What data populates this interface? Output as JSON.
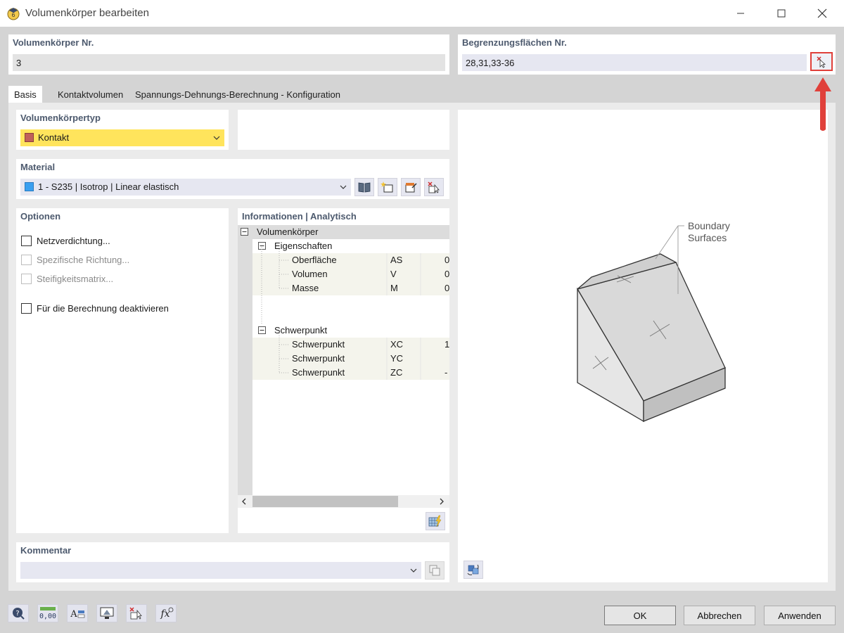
{
  "window": {
    "title": "Volumenkörper bearbeiten",
    "app_icon": "rfem-app-icon"
  },
  "solid_no": {
    "label": "Volumenkörper Nr.",
    "value": "3"
  },
  "boundary": {
    "label": "Begrenzungsflächen Nr.",
    "value": "28,31,33-36",
    "pick_icon": "pick-select-icon"
  },
  "tabs": [
    {
      "label": "Basis",
      "active": true
    },
    {
      "label": "Kontaktvolumen",
      "active": false
    },
    {
      "label": "Spannungs-Dehnungs-Berechnung - Konfiguration",
      "active": false
    }
  ],
  "solid_type": {
    "label": "Volumenkörpertyp",
    "value": "Kontakt",
    "swatch_color": "#c0605a",
    "bg_color": "#ffe45c"
  },
  "material": {
    "label": "Material",
    "value": "1 - S235 | Isotrop | Linear elastisch",
    "swatch_color": "#3aa0f0"
  },
  "options": {
    "label": "Optionen",
    "items": [
      {
        "label": "Netzverdichtung...",
        "enabled": true,
        "checked": false
      },
      {
        "label": "Spezifische Richtung...",
        "enabled": false,
        "checked": false
      },
      {
        "label": "Steifigkeitsmatrix...",
        "enabled": false,
        "checked": false
      },
      {
        "label": "Für die Berechnung deaktivieren",
        "enabled": true,
        "checked": false
      }
    ]
  },
  "info": {
    "label": "Informationen | Analytisch",
    "root": "Volumenkörper",
    "groups": [
      {
        "label": "Eigenschaften",
        "rows": [
          {
            "name": "Oberfläche",
            "symbol": "AS",
            "value": "0"
          },
          {
            "name": "Volumen",
            "symbol": "V",
            "value": "0"
          },
          {
            "name": "Masse",
            "symbol": "M",
            "value": "0"
          }
        ]
      },
      {
        "label": "Schwerpunkt",
        "rows": [
          {
            "name": "Schwerpunkt",
            "symbol": "XC",
            "value": "1"
          },
          {
            "name": "Schwerpunkt",
            "symbol": "YC",
            "value": ""
          },
          {
            "name": "Schwerpunkt",
            "symbol": "ZC",
            "value": "-"
          }
        ]
      }
    ]
  },
  "preview": {
    "annotation_line1": "Boundary",
    "annotation_line2": "Surfaces",
    "arrow_color": "#e0403a"
  },
  "comment": {
    "label": "Kommentar",
    "value": ""
  },
  "buttons": {
    "ok": "OK",
    "cancel": "Abbrechen",
    "apply": "Anwenden"
  },
  "bottom_icons": [
    "help-icon",
    "units-icon",
    "text-format-icon",
    "view-icon",
    "select-icon",
    "formula-icon"
  ]
}
